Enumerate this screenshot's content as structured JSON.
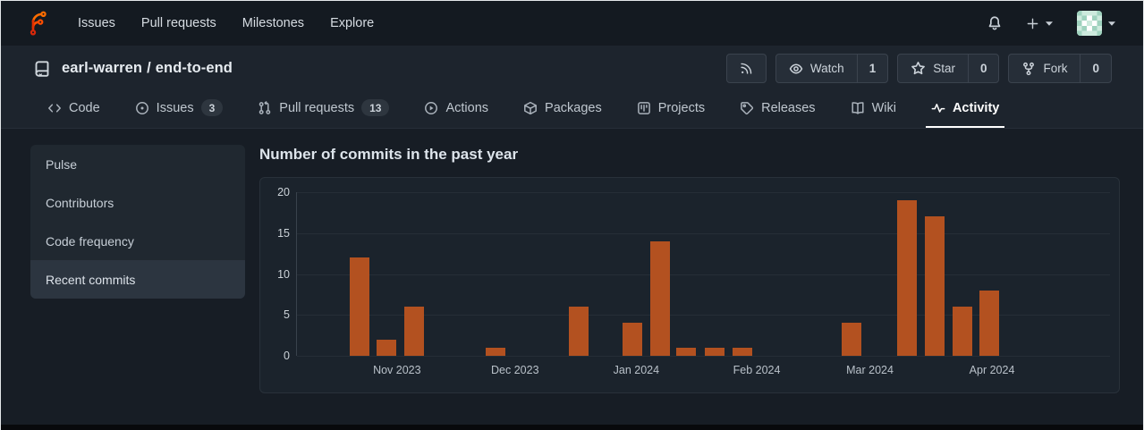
{
  "navbar": {
    "logo": "forgejo-logo",
    "links": [
      {
        "label": "Issues"
      },
      {
        "label": "Pull requests"
      },
      {
        "label": "Milestones"
      },
      {
        "label": "Explore"
      }
    ],
    "right_icons": [
      "bell-icon",
      "plus-dropdown",
      "avatar-dropdown"
    ]
  },
  "repo": {
    "owner": "earl-warren",
    "separator": "/",
    "name": "end-to-end"
  },
  "repo_actions": {
    "rss": {
      "icon": "rss-icon"
    },
    "watch": {
      "label": "Watch",
      "count": "1",
      "icon": "eye-icon"
    },
    "star": {
      "label": "Star",
      "count": "0",
      "icon": "star-icon"
    },
    "fork": {
      "label": "Fork",
      "count": "0",
      "icon": "fork-icon"
    }
  },
  "tabs": [
    {
      "label": "Code",
      "icon": "code-icon"
    },
    {
      "label": "Issues",
      "icon": "issue-opened-icon",
      "badge": "3"
    },
    {
      "label": "Pull requests",
      "icon": "git-pull-request-icon",
      "badge": "13"
    },
    {
      "label": "Actions",
      "icon": "play-circle-icon"
    },
    {
      "label": "Packages",
      "icon": "package-icon"
    },
    {
      "label": "Projects",
      "icon": "project-board-icon"
    },
    {
      "label": "Releases",
      "icon": "tag-icon"
    },
    {
      "label": "Wiki",
      "icon": "book-icon"
    },
    {
      "label": "Activity",
      "icon": "pulse-icon",
      "active": true
    }
  ],
  "sidebar": {
    "items": [
      {
        "label": "Pulse"
      },
      {
        "label": "Contributors"
      },
      {
        "label": "Code frequency"
      },
      {
        "label": "Recent commits",
        "active": true
      }
    ]
  },
  "main": {
    "title": "Number of commits in the past year"
  },
  "chart_data": {
    "type": "bar",
    "title": "Number of commits in the past year",
    "xlabel": "",
    "ylabel": "",
    "ylim": [
      0,
      20
    ],
    "yticks": [
      0,
      5,
      10,
      15,
      20
    ],
    "grid": true,
    "legend": false,
    "bar_color": "#b35120",
    "values": [
      12,
      2,
      6,
      1,
      6,
      4,
      14,
      1,
      1,
      1,
      4,
      19,
      17,
      6,
      8
    ],
    "bars": [
      {
        "value": 12,
        "x_pct": 7.7
      },
      {
        "value": 2,
        "x_pct": 11.0
      },
      {
        "value": 6,
        "x_pct": 14.4
      },
      {
        "value": 1,
        "x_pct": 24.4
      },
      {
        "value": 6,
        "x_pct": 34.6
      },
      {
        "value": 4,
        "x_pct": 41.3
      },
      {
        "value": 14,
        "x_pct": 44.7
      },
      {
        "value": 1,
        "x_pct": 47.9
      },
      {
        "value": 1,
        "x_pct": 51.4
      },
      {
        "value": 1,
        "x_pct": 54.8
      },
      {
        "value": 4,
        "x_pct": 68.2
      },
      {
        "value": 19,
        "x_pct": 75.0
      },
      {
        "value": 17,
        "x_pct": 78.4
      },
      {
        "value": 6,
        "x_pct": 81.8
      },
      {
        "value": 8,
        "x_pct": 85.1
      }
    ],
    "x_labels": [
      {
        "label": "Nov 2023",
        "x_pct": 12.4
      },
      {
        "label": "Dec 2023",
        "x_pct": 26.9
      },
      {
        "label": "Jan 2024",
        "x_pct": 41.8
      },
      {
        "label": "Feb 2024",
        "x_pct": 56.6
      },
      {
        "label": "Mar 2024",
        "x_pct": 70.5
      },
      {
        "label": "Apr 2024",
        "x_pct": 85.5
      }
    ]
  },
  "colors": {
    "brand_orange": "#ff6d00",
    "brand_red": "#d8280a",
    "chart_bar": "#b35120",
    "active_tab_underline": "#ffffff",
    "header_bg": "#1d242d",
    "navbar_bg": "#141a21",
    "page_bg": "#171d25",
    "panel_bg": "#1b232c"
  }
}
